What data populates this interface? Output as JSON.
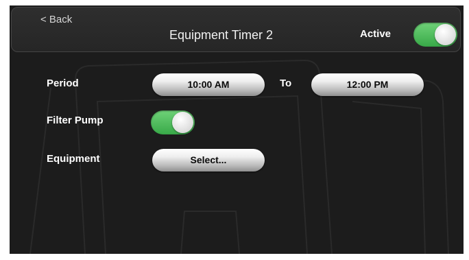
{
  "header": {
    "back_label": "< Back",
    "title": "Equipment Timer 2",
    "active_label": "Active",
    "active_on": true
  },
  "period": {
    "label": "Period",
    "start": "10:00 AM",
    "separator": "To",
    "end": "12:00 PM"
  },
  "filter_pump": {
    "label": "Filter Pump",
    "on": true
  },
  "equipment": {
    "label": "Equipment",
    "select_label": "Select..."
  },
  "colors": {
    "background": "#1c1c1c",
    "toggle_on": "#4cbc5a",
    "pill": "#e6e6e6"
  }
}
